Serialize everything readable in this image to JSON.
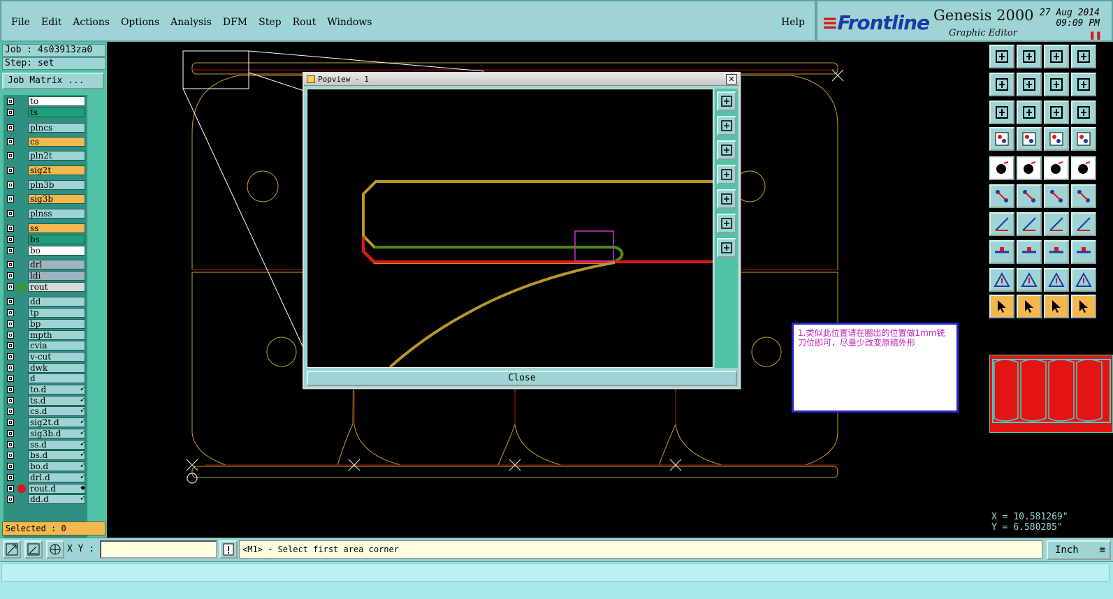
{
  "menu": {
    "items": [
      "File",
      "Edit",
      "Actions",
      "Options",
      "Analysis",
      "DFM",
      "Step",
      "Rout",
      "Windows"
    ],
    "help": "Help"
  },
  "brand": {
    "logo": "Frontline",
    "product": "Genesis 2000",
    "subtitle": "Graphic Editor",
    "date": "27  Aug  2014",
    "time": "09:09  PM"
  },
  "left": {
    "job": "Job  :  4s03913za0",
    "step": "Step:  set",
    "job_matrix": "Job Matrix ...",
    "selected": "Selected : 0",
    "layers": [
      {
        "name": "to",
        "color": "#ffffff"
      },
      {
        "name": "ts",
        "color": "#1f9e7a"
      },
      {
        "name": "plncs",
        "color": "#9ed4d4"
      },
      {
        "name": "cs",
        "color": "#f3b84f"
      },
      {
        "name": "pln2t",
        "color": "#9ed4d4"
      },
      {
        "name": "sig2t",
        "color": "#f3b84f"
      },
      {
        "name": "pln3b",
        "color": "#9ed4d4"
      },
      {
        "name": "sig3b",
        "color": "#f3b84f"
      },
      {
        "name": "plnss",
        "color": "#9ed4d4"
      },
      {
        "name": "ss",
        "color": "#f3b84f"
      },
      {
        "name": "bs",
        "color": "#1f9e7a"
      },
      {
        "name": "bo",
        "color": "#ffffff"
      },
      {
        "name": "drl",
        "color": "#9fb4bf"
      },
      {
        "name": "ldi",
        "color": "#9fb4bf"
      },
      {
        "name": "rout",
        "color": "#d9d9d9"
      },
      {
        "name": "dd",
        "color": "#9ed4d4"
      },
      {
        "name": "tp",
        "color": "#9ed4d4"
      },
      {
        "name": "bp",
        "color": "#9ed4d4"
      },
      {
        "name": "mpth",
        "color": "#9ed4d4"
      },
      {
        "name": "cvia",
        "color": "#9ed4d4"
      },
      {
        "name": "v-cut",
        "color": "#9ed4d4"
      },
      {
        "name": "dwk",
        "color": "#9ed4d4"
      },
      {
        "name": "d",
        "color": "#9ed4d4"
      },
      {
        "name": "to.d",
        "color": "#9ed4d4"
      },
      {
        "name": "ts.d",
        "color": "#9ed4d4"
      },
      {
        "name": "cs.d",
        "color": "#9ed4d4"
      },
      {
        "name": "sig2t.d",
        "color": "#9ed4d4"
      },
      {
        "name": "sig3b.d",
        "color": "#9ed4d4"
      },
      {
        "name": "ss.d",
        "color": "#9ed4d4"
      },
      {
        "name": "bs.d",
        "color": "#9ed4d4"
      },
      {
        "name": "bo.d",
        "color": "#9ed4d4"
      },
      {
        "name": "drl.d",
        "color": "#9ed4d4"
      },
      {
        "name": "rout.d",
        "color": "#9ed4d4"
      },
      {
        "name": "dd.d",
        "color": "#9ed4d4"
      }
    ]
  },
  "popview": {
    "title": "Popview - 1",
    "close_label": "Close"
  },
  "note": {
    "text": "1.类似此位置请在圈出的位置做1mm铣刀位即可，尽量少改变原稿外形"
  },
  "coords": {
    "x": "X  =  10.581269\"",
    "y": "Y  =  6.580285\""
  },
  "status": {
    "xy_label": "X Y :",
    "xy_value": "",
    "prompt": "<M1> - Select first area corner",
    "unit": "Inch"
  },
  "colors": {
    "panel": "#9ed4d4",
    "layer_bg": "#52c3a6",
    "yellow": "#f3b84f",
    "rout_outline": "#c8a030",
    "rout_red": "#e41414",
    "green": "#4a8a10"
  }
}
